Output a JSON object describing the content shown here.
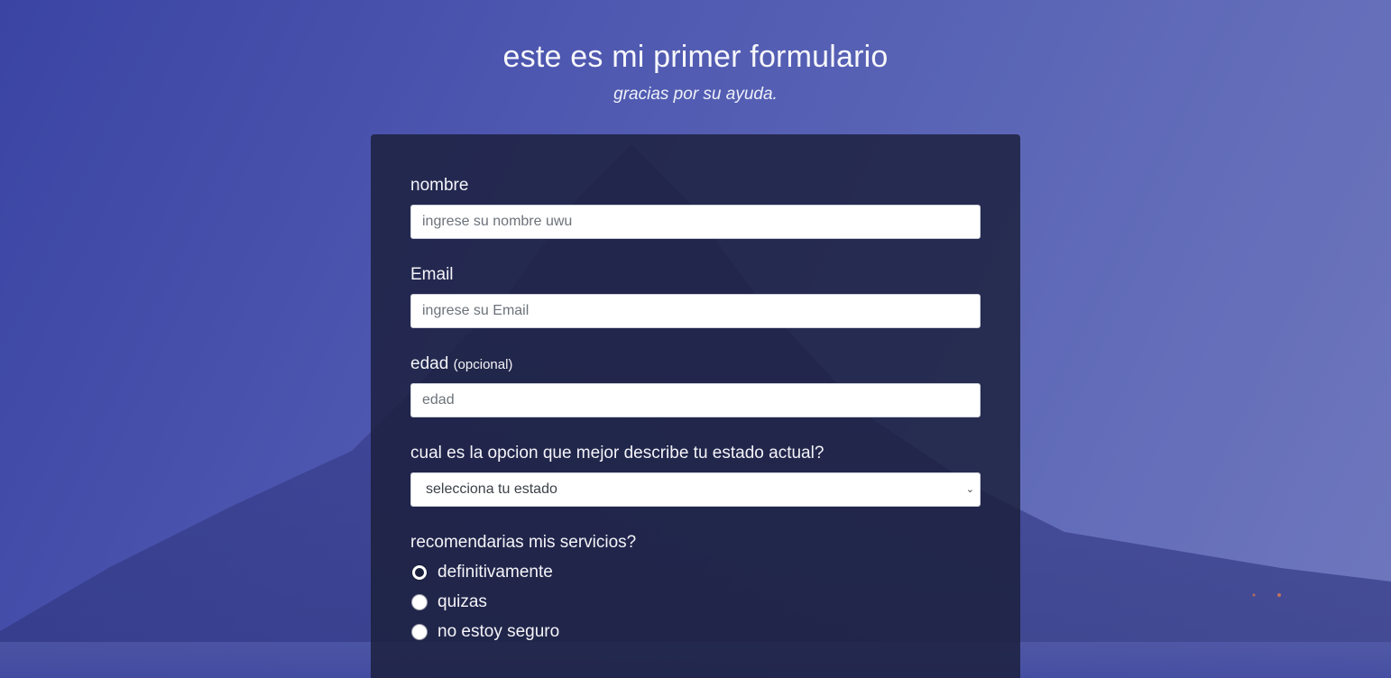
{
  "header": {
    "title": "este es mi primer formulario",
    "subtitle": "gracias por su ayuda."
  },
  "form": {
    "name": {
      "label": "nombre",
      "placeholder": "ingrese su nombre uwu"
    },
    "email": {
      "label": "Email",
      "placeholder": "ingrese su Email"
    },
    "age": {
      "label": "edad",
      "hint": "(opcional)",
      "placeholder": "edad"
    },
    "status": {
      "label": "cual es la opcion que mejor describe tu estado actual?",
      "selected": "selecciona tu estado"
    },
    "recommend": {
      "label": "recomendarias mis servicios?",
      "options": [
        {
          "label": "definitivamente",
          "checked": true
        },
        {
          "label": "quizas",
          "checked": false
        },
        {
          "label": "no estoy seguro",
          "checked": false
        }
      ]
    }
  },
  "colors": {
    "card": "#1b1e3a",
    "background": "#4e58b0"
  }
}
